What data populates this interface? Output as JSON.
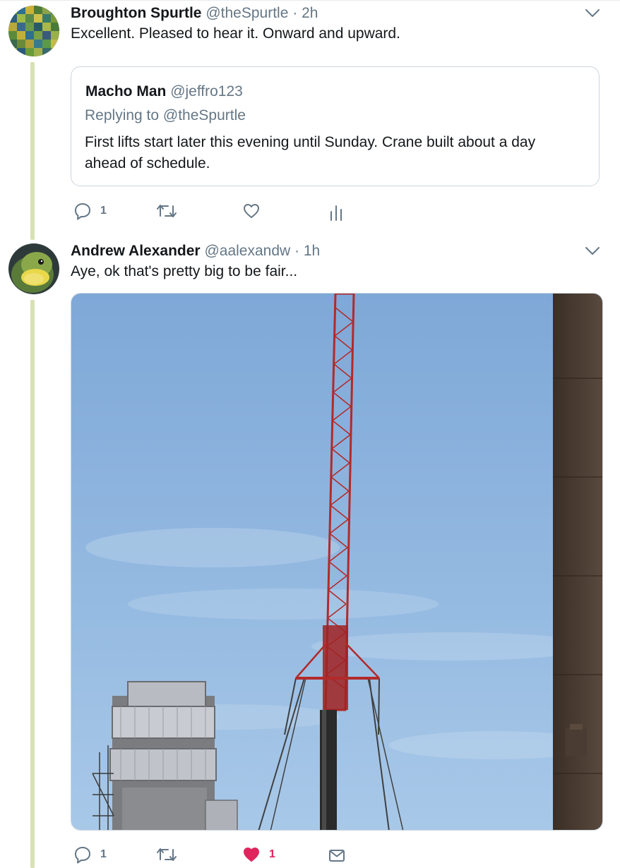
{
  "tweets": [
    {
      "display_name": "Broughton Spurtle",
      "handle": "@theSpurtle",
      "separator": "·",
      "time": "2h",
      "text": "Excellent. Pleased to hear it. Onward and upward.",
      "quote": {
        "display_name": "Macho Man",
        "handle": "@jeffro123",
        "replying_to": "Replying to @theSpurtle",
        "text": "First lifts start later this evening until Sunday. Crane built about a day ahead of schedule."
      },
      "actions": {
        "reply_count": "1",
        "like_count": ""
      }
    },
    {
      "display_name": "Andrew Alexander",
      "handle": "@aalexandw",
      "separator": "·",
      "time": "1h",
      "text": "Aye, ok that's pretty big to be fair...",
      "actions": {
        "reply_count": "1",
        "like_count": "1",
        "liked": true
      }
    }
  ],
  "colors": {
    "text": "#14171a",
    "secondary": "#657786",
    "border": "#ccd6dd",
    "thread_line": "#d8e1b4",
    "like_active": "#e0245e"
  },
  "icons": {
    "reply": "speech-bubble-icon",
    "retweet": "retweet-arrows-icon",
    "like": "heart-icon",
    "analytics": "bar-chart-icon",
    "dm": "envelope-icon",
    "more": "chevron-down-icon"
  }
}
